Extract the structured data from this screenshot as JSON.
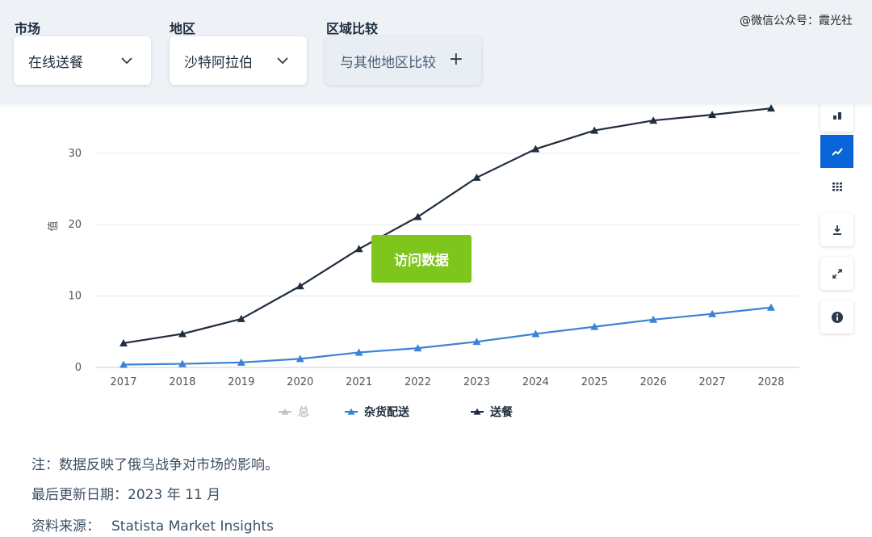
{
  "filters": {
    "market": {
      "label": "市场",
      "value": "在线送餐"
    },
    "region": {
      "label": "地区",
      "value": "沙特阿拉伯"
    },
    "compare": {
      "label": "区域比较",
      "value": "与其他地区比较"
    }
  },
  "watermark": "@微信公众号：霞光社",
  "cta_label": "访问数据",
  "sidebar_icons": [
    "bar-chart-icon",
    "line-chart-icon",
    "table-icon",
    "download-icon",
    "fullscreen-icon",
    "info-icon"
  ],
  "notes": {
    "note": "注：数据反映了俄乌战争对市场的影响。",
    "updated": "最后更新日期：2023 年 11 月",
    "source_label": "资料来源：",
    "source": "Statista Market Insights"
  },
  "colors": {
    "accent": "#0a66d8",
    "cta": "#7ec61b",
    "series_grocery": "#3b82d6",
    "series_meal": "#1f2d3d",
    "series_total": "#c0c4c8"
  },
  "chart_data": {
    "type": "line",
    "ylabel": "值",
    "x": [
      "2017",
      "2018",
      "2019",
      "2020",
      "2021",
      "2022",
      "2023",
      "2024",
      "2025",
      "2026",
      "2027",
      "2028"
    ],
    "yticks": [
      0,
      10,
      20,
      30
    ],
    "ylim": [
      0,
      37
    ],
    "grid": true,
    "legend_position": "bottom",
    "series": [
      {
        "name": "总",
        "values": [],
        "color": "#c0c4c8",
        "hidden": true
      },
      {
        "name": "杂货配送",
        "color": "#3b82d6",
        "values": [
          0.4,
          0.5,
          0.7,
          1.2,
          2.1,
          2.7,
          3.6,
          4.7,
          5.7,
          6.7,
          7.5,
          8.4
        ]
      },
      {
        "name": "送餐",
        "color": "#1f2d3d",
        "values": [
          3.4,
          4.7,
          6.8,
          11.4,
          16.6,
          21.1,
          26.6,
          30.6,
          33.2,
          34.6,
          35.4,
          36.3
        ]
      }
    ]
  }
}
